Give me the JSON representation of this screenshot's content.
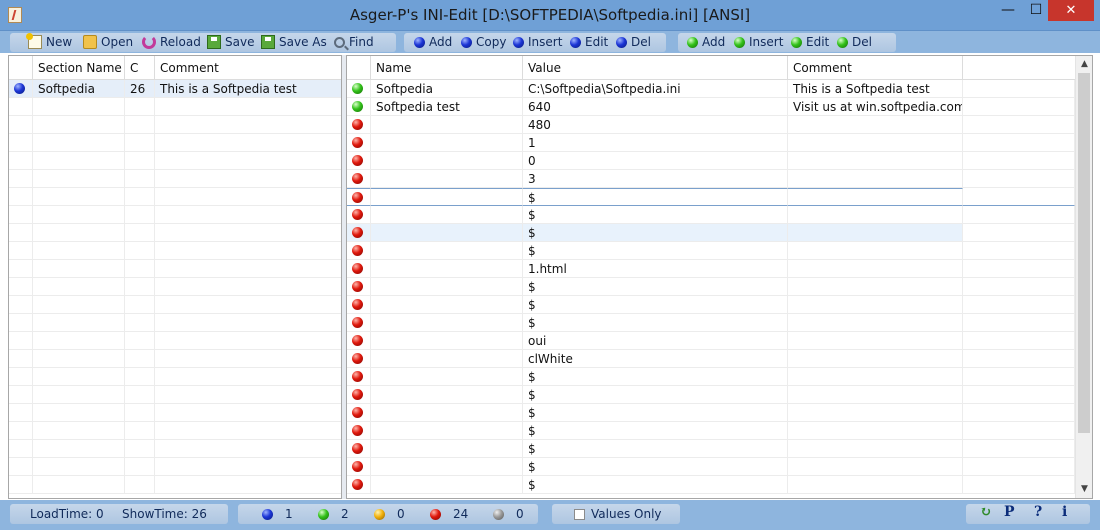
{
  "window": {
    "title": "Asger-P's INI-Edit   [D:\\SOFTPEDIA\\Softpedia.ini] [ANSI]",
    "minimize": "—",
    "maximize": "☐",
    "close": "✕"
  },
  "toolbar": {
    "new": "New",
    "open": "Open",
    "reload": "Reload",
    "save": "Save",
    "save_as": "Save As",
    "find": "Find",
    "section_add": "Add",
    "section_copy": "Copy",
    "section_insert": "Insert",
    "section_edit": "Edit",
    "section_del": "Del",
    "key_add": "Add",
    "key_insert": "Insert",
    "key_edit": "Edit",
    "key_del": "Del"
  },
  "sections": {
    "columns": [
      "Section Name",
      "C",
      "Comment"
    ],
    "rows": [
      {
        "icon": "blue",
        "name": "Softpedia",
        "count": "26",
        "comment": "This is a Softpedia test"
      }
    ]
  },
  "keys": {
    "columns": [
      "Name",
      "Value",
      "Comment"
    ],
    "rows": [
      {
        "icon": "green",
        "name": "Softpedia",
        "value": "C:\\Softpedia\\Softpedia.ini",
        "comment": "This is a Softpedia test"
      },
      {
        "icon": "green",
        "name": "Softpedia test",
        "value": "640",
        "comment": "Visit us at win.softpedia.com"
      },
      {
        "icon": "red",
        "name": "",
        "value": "480",
        "comment": ""
      },
      {
        "icon": "red",
        "name": "",
        "value": "1",
        "comment": ""
      },
      {
        "icon": "red",
        "name": "",
        "value": "0",
        "comment": ""
      },
      {
        "icon": "red",
        "name": "",
        "value": "3",
        "comment": ""
      },
      {
        "icon": "red",
        "name": "",
        "value": "$",
        "comment": ""
      },
      {
        "icon": "red",
        "name": "",
        "value": "$",
        "comment": ""
      },
      {
        "icon": "red",
        "name": "",
        "value": "$",
        "comment": ""
      },
      {
        "icon": "red",
        "name": "",
        "value": "$",
        "comment": ""
      },
      {
        "icon": "red",
        "name": "",
        "value": "1.html",
        "comment": ""
      },
      {
        "icon": "red",
        "name": "",
        "value": "$",
        "comment": ""
      },
      {
        "icon": "red",
        "name": "",
        "value": "$",
        "comment": ""
      },
      {
        "icon": "red",
        "name": "",
        "value": "$",
        "comment": ""
      },
      {
        "icon": "red",
        "name": "",
        "value": "oui",
        "comment": ""
      },
      {
        "icon": "red",
        "name": "",
        "value": "clWhite",
        "comment": ""
      },
      {
        "icon": "red",
        "name": "",
        "value": "$",
        "comment": ""
      },
      {
        "icon": "red",
        "name": "",
        "value": "$",
        "comment": ""
      },
      {
        "icon": "red",
        "name": "",
        "value": "$",
        "comment": ""
      },
      {
        "icon": "red",
        "name": "",
        "value": "$",
        "comment": ""
      },
      {
        "icon": "red",
        "name": "",
        "value": "$",
        "comment": ""
      },
      {
        "icon": "red",
        "name": "",
        "value": "$",
        "comment": ""
      },
      {
        "icon": "red",
        "name": "",
        "value": "$",
        "comment": ""
      }
    ]
  },
  "status": {
    "load_time": "LoadTime:  0",
    "show_time": "ShowTime:  26",
    "count_blue": "1",
    "count_green": "2",
    "count_yellow": "0",
    "count_red": "24",
    "count_gray": "0",
    "values_only": "Values Only",
    "icon_p": "P",
    "icon_help": "?",
    "icon_info": "i"
  }
}
